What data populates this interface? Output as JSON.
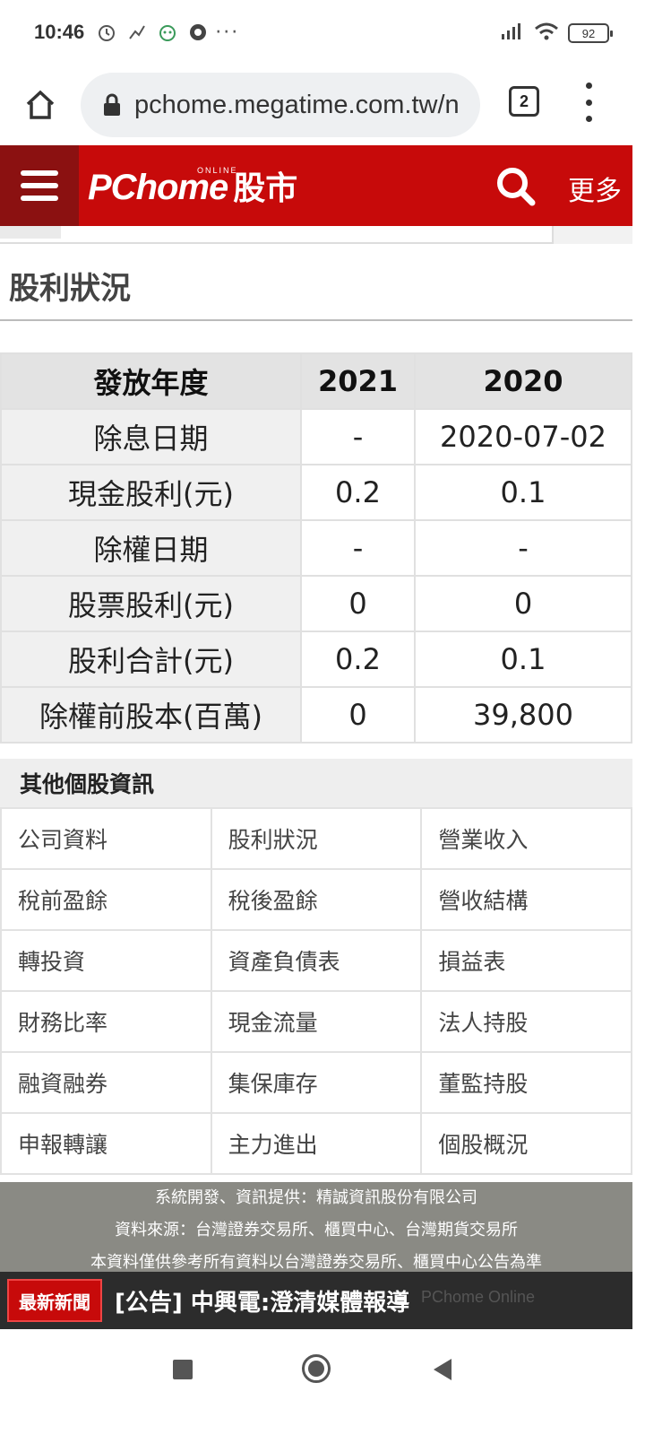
{
  "status_bar": {
    "time": "10:46",
    "dots": "···",
    "battery": "92"
  },
  "browser": {
    "url": "pchome.megatime.com.tw/n",
    "tab_count": "2"
  },
  "header": {
    "logo_main": "PChome",
    "logo_online": "ONLINE",
    "logo_stock": "股市",
    "more": "更多"
  },
  "section_title": "股利狀況",
  "dividend_table": {
    "header": [
      "發放年度",
      "2021",
      "2020"
    ],
    "rows": [
      [
        "除息日期",
        "-",
        "2020-07-02"
      ],
      [
        "現金股利(元)",
        "0.2",
        "0.1"
      ],
      [
        "除權日期",
        "-",
        "-"
      ],
      [
        "股票股利(元)",
        "0",
        "0"
      ],
      [
        "股利合計(元)",
        "0.2",
        "0.1"
      ],
      [
        "除權前股本(百萬)",
        "0",
        "39,800"
      ]
    ]
  },
  "other_info": {
    "title": "其他個股資訊",
    "links": [
      [
        "公司資料",
        "股利狀況",
        "營業收入"
      ],
      [
        "稅前盈餘",
        "稅後盈餘",
        "營收結構"
      ],
      [
        "轉投資",
        "資產負債表",
        "損益表"
      ],
      [
        "財務比率",
        "現金流量",
        "法人持股"
      ],
      [
        "融資融券",
        "集保庫存",
        "董監持股"
      ],
      [
        "申報轉讓",
        "主力進出",
        "個股概況"
      ]
    ]
  },
  "footer": {
    "line1": "系統開發、資訊提供：精誠資訊股份有限公司",
    "line2": "資料來源：台灣證券交易所、櫃買中心、台灣期貨交易所",
    "line3": "本資料僅供參考所有資料以台灣證券交易所、櫃買中心公告為準"
  },
  "news": {
    "badge": "最新新聞",
    "headline": "[公告] 中興電:澄清媒體報導",
    "ghost": "PChome Online"
  },
  "colors": {
    "brand_red": "#c70a0a",
    "hamburger_bg": "#8b1111",
    "footer_bg": "#8a8a84"
  }
}
